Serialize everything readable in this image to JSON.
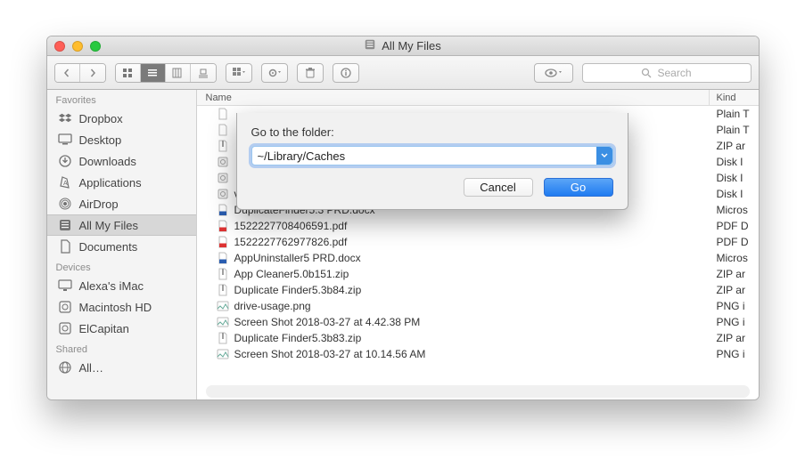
{
  "title": "All My Files",
  "toolbar": {
    "search_placeholder": "Search"
  },
  "sidebar": {
    "sections": [
      {
        "label": "Favorites",
        "items": [
          {
            "icon": "dropbox",
            "label": "Dropbox",
            "active": false
          },
          {
            "icon": "desktop",
            "label": "Desktop",
            "active": false
          },
          {
            "icon": "downloads",
            "label": "Downloads",
            "active": false
          },
          {
            "icon": "applications",
            "label": "Applications",
            "active": false
          },
          {
            "icon": "airdrop",
            "label": "AirDrop",
            "active": false
          },
          {
            "icon": "allmyfiles",
            "label": "All My Files",
            "active": true
          },
          {
            "icon": "documents",
            "label": "Documents",
            "active": false
          }
        ]
      },
      {
        "label": "Devices",
        "items": [
          {
            "icon": "imac",
            "label": "Alexa's iMac",
            "active": false
          },
          {
            "icon": "hdd",
            "label": "Macintosh HD",
            "active": false
          },
          {
            "icon": "hdd",
            "label": "ElCapitan",
            "active": false
          }
        ]
      },
      {
        "label": "Shared",
        "items": [
          {
            "icon": "globe",
            "label": "All…",
            "active": false
          }
        ]
      }
    ]
  },
  "columns": {
    "name": "Name",
    "kind": "Kind"
  },
  "files": [
    {
      "icon": "txt",
      "name": "",
      "kind": "Plain T"
    },
    {
      "icon": "txt",
      "name": "",
      "kind": "Plain T"
    },
    {
      "icon": "zip",
      "name": "",
      "kind": "ZIP ar"
    },
    {
      "icon": "dmg",
      "name": "",
      "kind": "Disk I"
    },
    {
      "icon": "dmg",
      "name": "",
      "kind": "Disk I"
    },
    {
      "icon": "dmg",
      "name": "vsdxannotator.dmg",
      "kind": "Disk I"
    },
    {
      "icon": "docx",
      "name": "DuplicateFinder5.3 PRD.docx",
      "kind": "Micros"
    },
    {
      "icon": "pdf",
      "name": "1522227708406591.pdf",
      "kind": "PDF D"
    },
    {
      "icon": "pdf",
      "name": "1522227762977826.pdf",
      "kind": "PDF D"
    },
    {
      "icon": "docx",
      "name": "AppUninstaller5 PRD.docx",
      "kind": "Micros"
    },
    {
      "icon": "zip",
      "name": "App Cleaner5.0b151.zip",
      "kind": "ZIP ar"
    },
    {
      "icon": "zip",
      "name": "Duplicate Finder5.3b84.zip",
      "kind": "ZIP ar"
    },
    {
      "icon": "png",
      "name": "drive-usage.png",
      "kind": "PNG i"
    },
    {
      "icon": "png",
      "name": "Screen Shot 2018-03-27 at 4.42.38 PM",
      "kind": "PNG i"
    },
    {
      "icon": "zip",
      "name": "Duplicate Finder5.3b83.zip",
      "kind": "ZIP ar"
    },
    {
      "icon": "png",
      "name": "Screen Shot 2018-03-27 at 10.14.56 AM",
      "kind": "PNG i"
    }
  ],
  "dialog": {
    "label": "Go to the folder:",
    "value": "~/Library/Caches",
    "cancel": "Cancel",
    "go": "Go"
  }
}
